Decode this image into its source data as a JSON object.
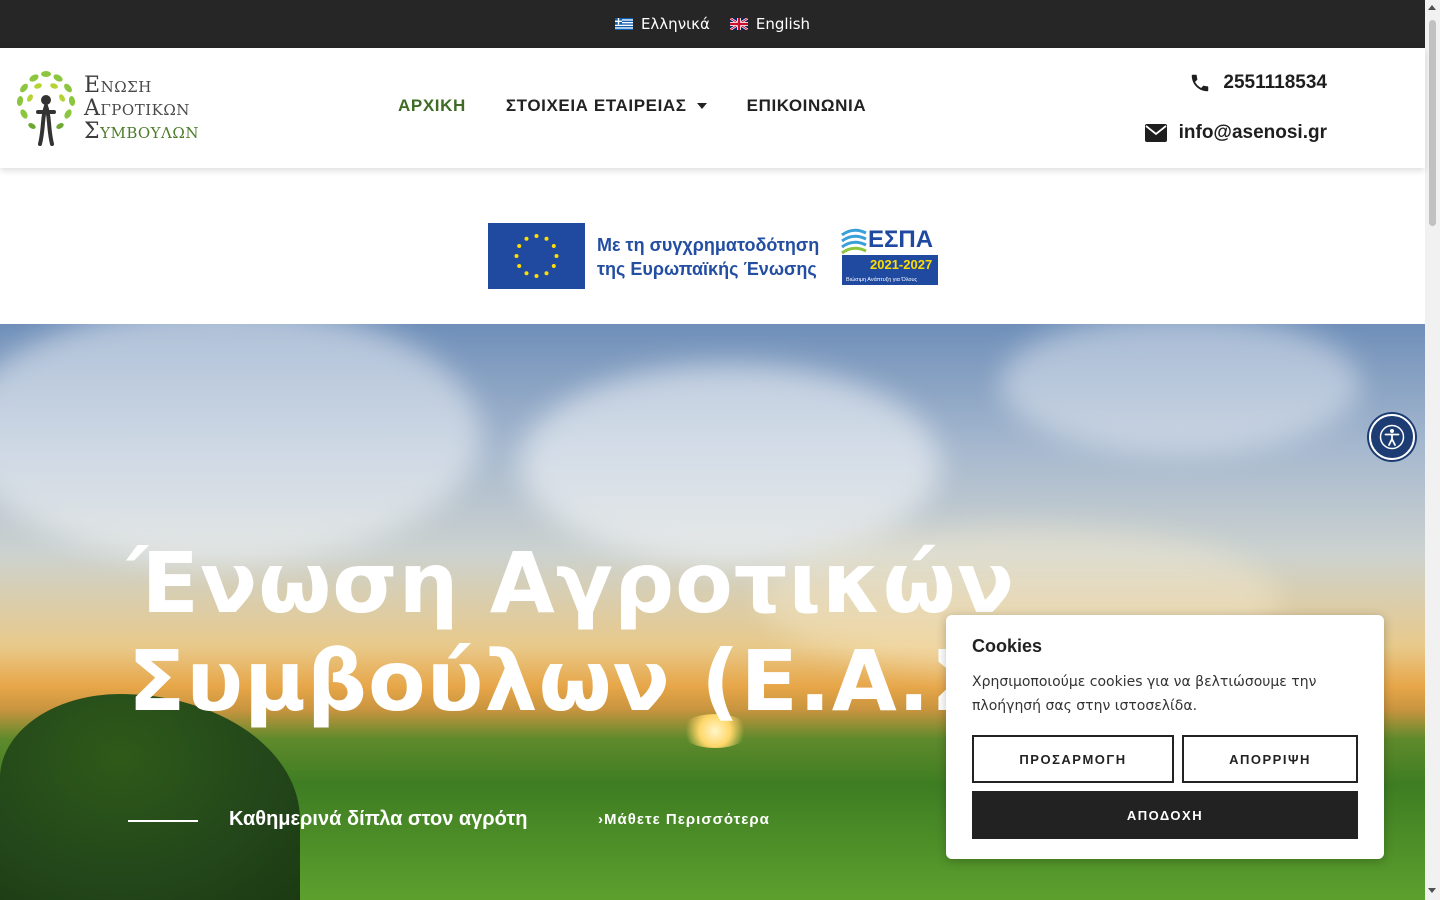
{
  "language_bar": {
    "greek_label": "Ελληνικά",
    "english_label": "English"
  },
  "logo": {
    "line1_cap": "Ε",
    "line1_rest": "ΝΩΣΗ",
    "line2_cap": "Α",
    "line2_rest": "ΓΡΟΤΙΚΩΝ",
    "line3_cap": "Σ",
    "line3_rest": "ΥΜΒΟΥΛΩΝ"
  },
  "nav": {
    "home": "ΑΡΧΙΚΗ",
    "company": "ΣΤΟΙΧΕΙΑ ΕΤΑΙΡΕΙΑΣ",
    "contact": "ΕΠΙΚΟΙΝΩΝΙΑ"
  },
  "contact": {
    "phone": "2551118534",
    "email": "info@asenosi.gr"
  },
  "eu_banner": {
    "line1": "Με τη συγχρηματοδότηση",
    "line2": "της Ευρωπαϊκής Ένωσης",
    "espa_title": "ΕΣΠΑ",
    "espa_years": "2021-2027",
    "espa_sub": "Βιώσιμη Ανάπτυξη για Όλους"
  },
  "hero": {
    "title": "Ένωση Αγροτικών\nΣυμβούλων (Ε.Α.Σ",
    "tagline": "Καθημερινά δίπλα στον αγρότη",
    "learn_more": "›Μάθετε Περισσότερα"
  },
  "cookies": {
    "title": "Cookies",
    "text": "Χρησιμοποιούμε cookies για να βελτιώσουμε την πλοήγησή σας στην ιστοσελίδα.",
    "customize": "ΠΡΟΣΑΡΜΟΓΗ",
    "reject": "ΑΠΟΡΡΙΨΗ",
    "accept": "ΑΠΟΔΟΧΗ"
  },
  "colors": {
    "accent_green": "#3f6b25",
    "topbar": "#262626",
    "eu_blue": "#1f4aa0",
    "a11y_blue": "#1e3c74"
  },
  "icons": [
    "greek-flag-icon",
    "uk-flag-icon",
    "phone-icon",
    "envelope-icon",
    "chevron-down-icon",
    "accessibility-icon",
    "eu-flag-icon",
    "espa-logo-icon",
    "tree-people-logo-icon"
  ]
}
